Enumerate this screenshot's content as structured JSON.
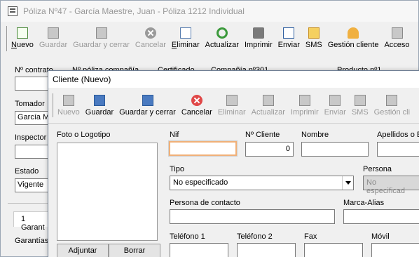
{
  "back": {
    "title": "Póliza Nº47 - García Maestre, Juan - Póliza 1212 Individual",
    "toolbar": [
      {
        "label": "Nuevo",
        "u": "N",
        "rest": "uevo",
        "enabled": true
      },
      {
        "label": "Guardar",
        "enabled": false
      },
      {
        "label": "Guardar y cerrar",
        "enabled": false
      },
      {
        "label": "Cancelar",
        "enabled": false
      },
      {
        "label": "Eliminar",
        "u": "E",
        "rest": "liminar",
        "enabled": true
      },
      {
        "label": "Actualizar",
        "enabled": true
      },
      {
        "label": "Imprimir",
        "enabled": true
      },
      {
        "label": "Enviar",
        "enabled": true
      },
      {
        "label": "SMS",
        "enabled": true
      },
      {
        "label": "Gestión cliente",
        "enabled": true
      },
      {
        "label": "Acceso",
        "enabled": true
      }
    ],
    "labels": {
      "contrato": "Nº contrato",
      "poliza_compania": "Nº póliza compañía",
      "certificado": "Certificado",
      "compania": "Compañía nº301",
      "producto": "Producto nº1",
      "tomador": "Tomador",
      "inspector": "Inspector",
      "estado": "Estado",
      "garantias": "Garantías"
    },
    "tomador_value": "García M",
    "estado_value": "Vigente",
    "garantias_tab": "1 Garant"
  },
  "dialog": {
    "title": "Cliente (Nuevo)",
    "toolbar": [
      {
        "label": "Nuevo",
        "enabled": false
      },
      {
        "label": "Guardar",
        "enabled": true
      },
      {
        "label": "Guardar y cerrar",
        "enabled": true
      },
      {
        "label": "Cancelar",
        "enabled": true
      },
      {
        "label": "Eliminar",
        "enabled": false
      },
      {
        "label": "Actualizar",
        "enabled": false
      },
      {
        "label": "Imprimir",
        "enabled": false
      },
      {
        "label": "Enviar",
        "enabled": false
      },
      {
        "label": "SMS",
        "enabled": false
      },
      {
        "label": "Gestión cli",
        "enabled": false
      }
    ],
    "photo_label": "Foto o Logotipo",
    "adjuntar": "Adjuntar",
    "borrar": "Borrar",
    "fields": {
      "nif_label": "Nif",
      "nif_value": "",
      "ncliente_label": "Nº Cliente",
      "ncliente_value": "0",
      "nombre_label": "Nombre",
      "apellidos_label": "Apellidos o E",
      "tipo_label": "Tipo",
      "tipo_value": "No especificado",
      "persona_label": "Persona",
      "persona_value": "No especificad",
      "contacto_label": "Persona de contacto",
      "marca_label": "Marca-Alias",
      "tel1_label": "Teléfono 1",
      "tel2_label": "Teléfono 2",
      "fax_label": "Fax",
      "movil_label": "Móvil"
    }
  }
}
